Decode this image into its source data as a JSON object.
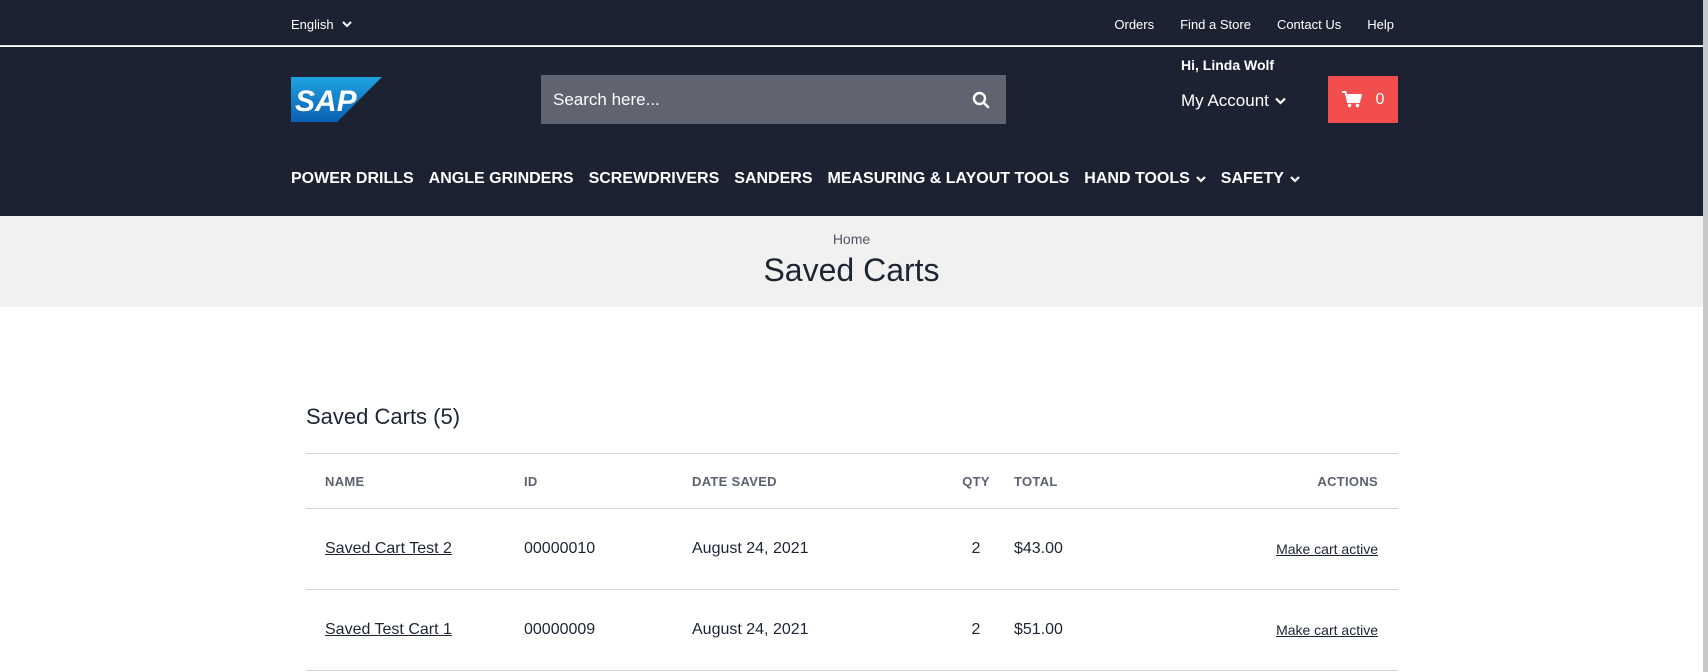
{
  "topbar": {
    "language": "English",
    "links": [
      "Orders",
      "Find a Store",
      "Contact Us",
      "Help"
    ]
  },
  "header": {
    "logo_text": "SAP",
    "search_placeholder": "Search here...",
    "greeting": "Hi, Linda Wolf",
    "account_label": "My Account",
    "cart_count": "0"
  },
  "nav": {
    "items": [
      {
        "label": "POWER DRILLS",
        "dropdown": false
      },
      {
        "label": "ANGLE GRINDERS",
        "dropdown": false
      },
      {
        "label": "SCREWDRIVERS",
        "dropdown": false
      },
      {
        "label": "SANDERS",
        "dropdown": false
      },
      {
        "label": "MEASURING & LAYOUT TOOLS",
        "dropdown": false
      },
      {
        "label": "HAND TOOLS",
        "dropdown": true
      },
      {
        "label": "SAFETY",
        "dropdown": true
      }
    ]
  },
  "page": {
    "breadcrumb": "Home",
    "title": "Saved Carts",
    "section_title": "Saved Carts (5)"
  },
  "table": {
    "headers": {
      "name": "NAME",
      "id": "ID",
      "date": "DATE SAVED",
      "qty": "QTY",
      "total": "TOTAL",
      "actions": "ACTIONS"
    },
    "rows": [
      {
        "name": "Saved Cart Test 2",
        "id": "00000010",
        "date": "August 24, 2021",
        "qty": "2",
        "total": "$43.00",
        "action": "Make cart active"
      },
      {
        "name": "Saved Test Cart 1",
        "id": "00000009",
        "date": "August 24, 2021",
        "qty": "2",
        "total": "$51.00",
        "action": "Make cart active"
      }
    ]
  },
  "colors": {
    "header_bg": "#1d2232",
    "cart_button": "#f24e4e",
    "search_bg": "#5f6470",
    "title_band": "#f1f1f1"
  }
}
